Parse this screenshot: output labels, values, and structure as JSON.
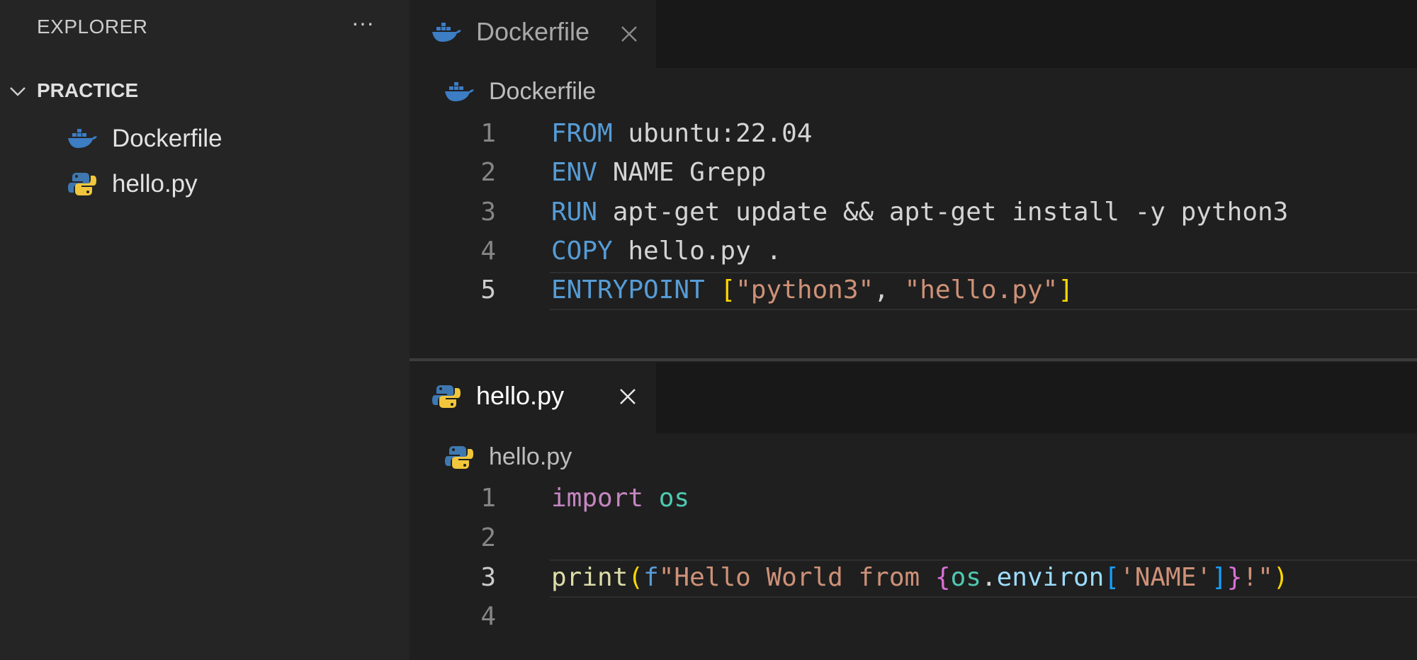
{
  "sidebar": {
    "header": "EXPLORER",
    "more": "···",
    "folder": "PRACTICE",
    "files": [
      {
        "name": "Dockerfile",
        "icon": "docker-icon"
      },
      {
        "name": "hello.py",
        "icon": "python-icon"
      }
    ]
  },
  "editors": [
    {
      "tab": {
        "label": "Dockerfile",
        "icon": "docker-icon",
        "active": false
      },
      "breadcrumb": "Dockerfile",
      "lines": [
        {
          "n": "1",
          "tokens": [
            [
              "kw",
              "FROM"
            ],
            [
              "pl",
              " ubuntu:22.04"
            ]
          ]
        },
        {
          "n": "2",
          "tokens": [
            [
              "kw",
              "ENV"
            ],
            [
              "pl",
              " NAME Grepp"
            ]
          ]
        },
        {
          "n": "3",
          "tokens": [
            [
              "kw",
              "RUN"
            ],
            [
              "pl",
              " apt-get update && apt-get install -y python3"
            ]
          ]
        },
        {
          "n": "4",
          "tokens": [
            [
              "kw",
              "COPY"
            ],
            [
              "pl",
              " hello.py ."
            ]
          ]
        },
        {
          "n": "5",
          "tokens": [
            [
              "kw",
              "ENTRYPOINT"
            ],
            [
              "pl",
              " "
            ],
            [
              "br",
              "["
            ],
            [
              "str",
              "\"python3\""
            ],
            [
              "pl",
              ", "
            ],
            [
              "str",
              "\"hello.py\""
            ],
            [
              "br",
              "]"
            ]
          ],
          "current": true
        }
      ]
    },
    {
      "tab": {
        "label": "hello.py",
        "icon": "python-icon",
        "active": true
      },
      "breadcrumb": "hello.py",
      "lines": [
        {
          "n": "1",
          "tokens": [
            [
              "imp",
              "import"
            ],
            [
              "pl",
              " "
            ],
            [
              "mod",
              "os"
            ]
          ]
        },
        {
          "n": "2",
          "tokens": []
        },
        {
          "n": "3",
          "tokens": [
            [
              "fn",
              "print"
            ],
            [
              "br",
              "("
            ],
            [
              "fmt",
              "f"
            ],
            [
              "str",
              "\"Hello World from "
            ],
            [
              "br2",
              "{"
            ],
            [
              "mod",
              "os"
            ],
            [
              "pl",
              "."
            ],
            [
              "var",
              "environ"
            ],
            [
              "br3",
              "["
            ],
            [
              "str",
              "'NAME'"
            ],
            [
              "br3",
              "]"
            ],
            [
              "br2",
              "}"
            ],
            [
              "str",
              "!\""
            ],
            [
              "br",
              ")"
            ]
          ],
          "current": true
        },
        {
          "n": "4",
          "tokens": []
        }
      ]
    }
  ],
  "colors": {
    "background": "#1f1f1f",
    "sidebar": "#252526",
    "keyword": "#569cd6",
    "string": "#ce9178"
  }
}
